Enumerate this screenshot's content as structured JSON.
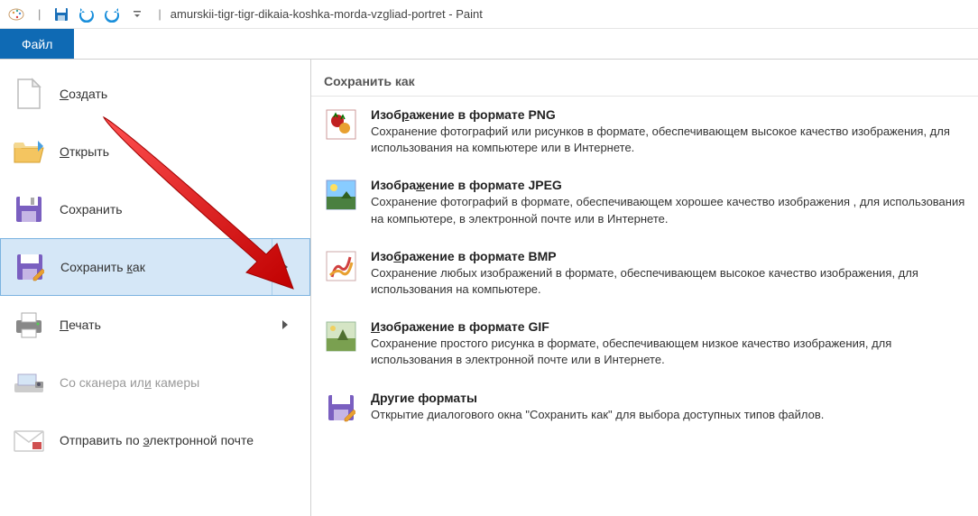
{
  "titlebar": {
    "title": "amurskii-tigr-tigr-dikaia-koshka-morda-vzgliad-portret - Paint"
  },
  "tabs": {
    "file": "Файл"
  },
  "file_menu": {
    "create": "Создать",
    "open": "Открыть",
    "save": "Сохранить",
    "save_as": "Сохранить как",
    "print": "Печать",
    "scanner": "Со сканера или камеры",
    "email": "Отправить по электронной почте"
  },
  "submenu": {
    "title": "Сохранить как",
    "png": {
      "label": "Изображение в формате PNG",
      "desc": "Сохранение фотографий или рисунков в формате, обеспечивающем высокое качество изображения, для использования на компьютере или в Интернете."
    },
    "jpeg": {
      "label": "Изображение в формате JPEG",
      "desc": "Сохранение фотографий в формате, обеспечивающем хорошее качество изображения , для использования на компьютере, в электронной почте или в Интернете."
    },
    "bmp": {
      "label": "Изображение в формате BMP",
      "desc": "Сохранение любых изображений в формате, обеспечивающем высокое качество изображения, для использования на компьютере."
    },
    "gif": {
      "label": "Изображение в формате GIF",
      "desc": "Сохранение простого рисунка в формате, обеспечивающем низкое качество изображения, для использования в электронной почте или в Интернете."
    },
    "other": {
      "label": "Другие форматы",
      "desc": "Открытие диалогового окна \"Сохранить как\" для выбора доступных типов файлов."
    }
  }
}
